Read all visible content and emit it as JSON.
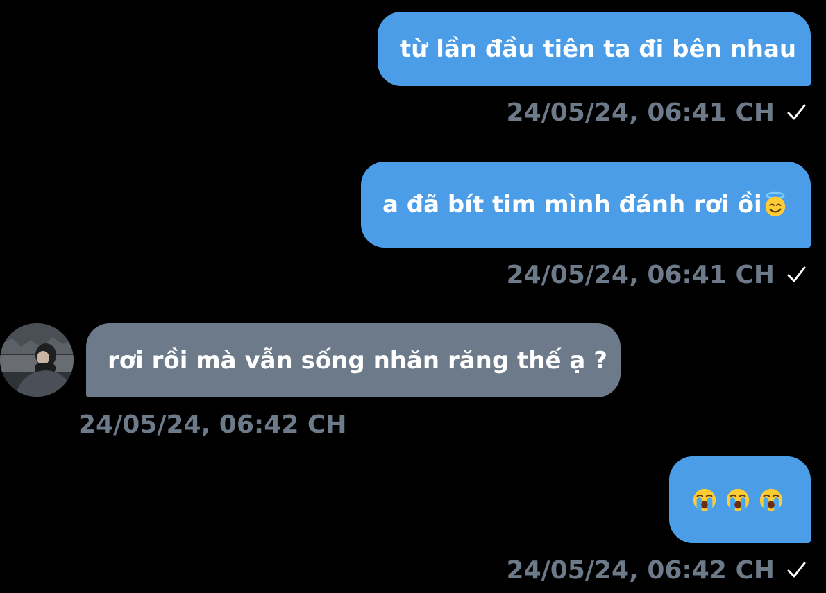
{
  "messages": [
    {
      "text": "từ lần đầu tiên ta đi bên nhau",
      "timestamp": "24/05/24, 06:41 CH"
    },
    {
      "text": "a đã bít tim mình đánh rơi ồi",
      "emoji": "smiling-face-with-halo",
      "timestamp": "24/05/24, 06:41 CH"
    },
    {
      "text": "rơi rồi mà vẫn sống nhăn răng thế ạ ?",
      "timestamp": "24/05/24, 06:42 CH"
    },
    {
      "emojis": [
        "loudly-crying-face",
        "loudly-crying-face",
        "loudly-crying-face"
      ],
      "timestamp": "24/05/24, 06:42 CH"
    }
  ],
  "colors": {
    "outgoing_bubble": "#4b9de8",
    "incoming_bubble": "#6d7a8a",
    "timestamp": "#6d7a8a",
    "background": "#000000"
  },
  "icons": {
    "read_receipt": "checkmark-icon",
    "avatar": "contact-avatar"
  }
}
